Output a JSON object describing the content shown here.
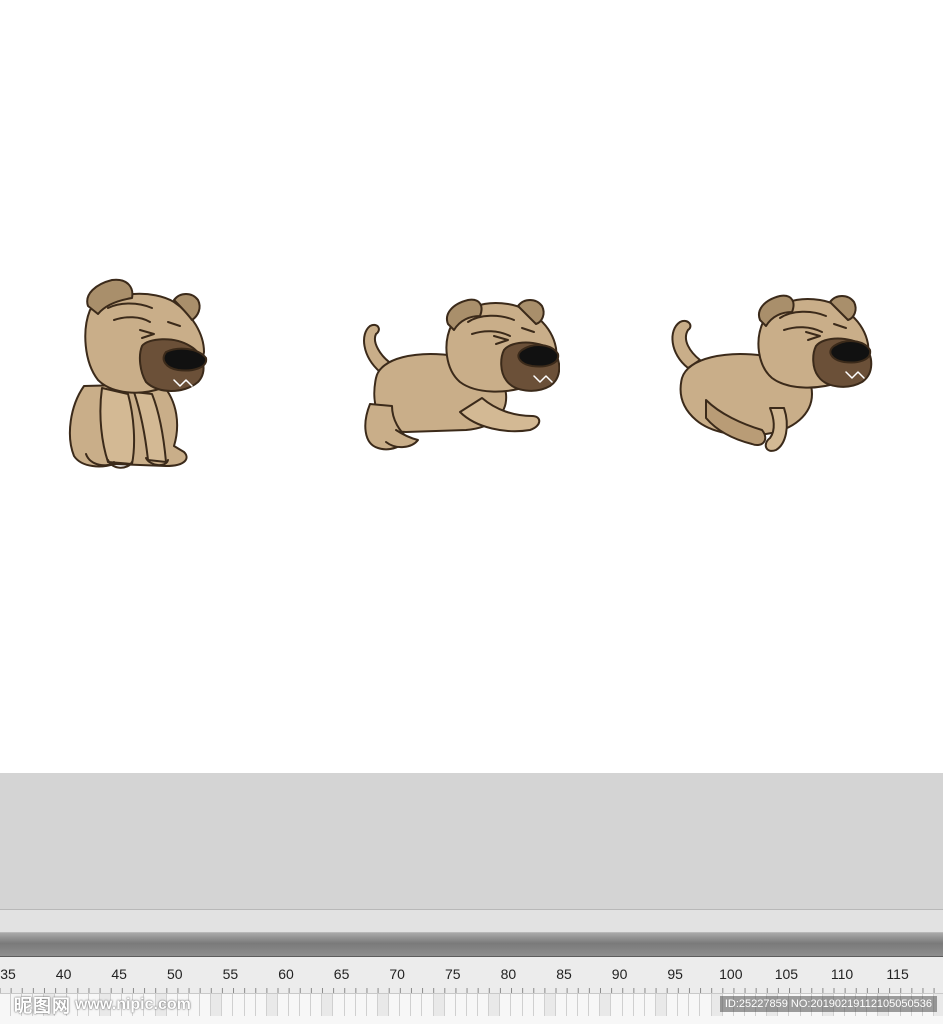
{
  "stage": {
    "background": "#ffffff",
    "sprites": [
      {
        "name": "sitting-dog",
        "pose": "sitting"
      },
      {
        "name": "crouching-dog",
        "pose": "crouching"
      },
      {
        "name": "leaping-dog",
        "pose": "leaping"
      }
    ],
    "dog_colors": {
      "fur": "#c9ae89",
      "fur_shadow": "#a98f6b",
      "muzzle": "#6b5038",
      "nose": "#111111",
      "outline": "#3b2a1a"
    }
  },
  "timeline": {
    "ruler_labels": [
      "35",
      "40",
      "45",
      "50",
      "55",
      "60",
      "65",
      "70",
      "75",
      "80",
      "85",
      "90",
      "95",
      "100",
      "105",
      "110",
      "115"
    ]
  },
  "watermark": {
    "logo": "昵图网",
    "url": "www.nipic.com",
    "id_text": "ID:25227859 NO:20190219112105050536"
  }
}
